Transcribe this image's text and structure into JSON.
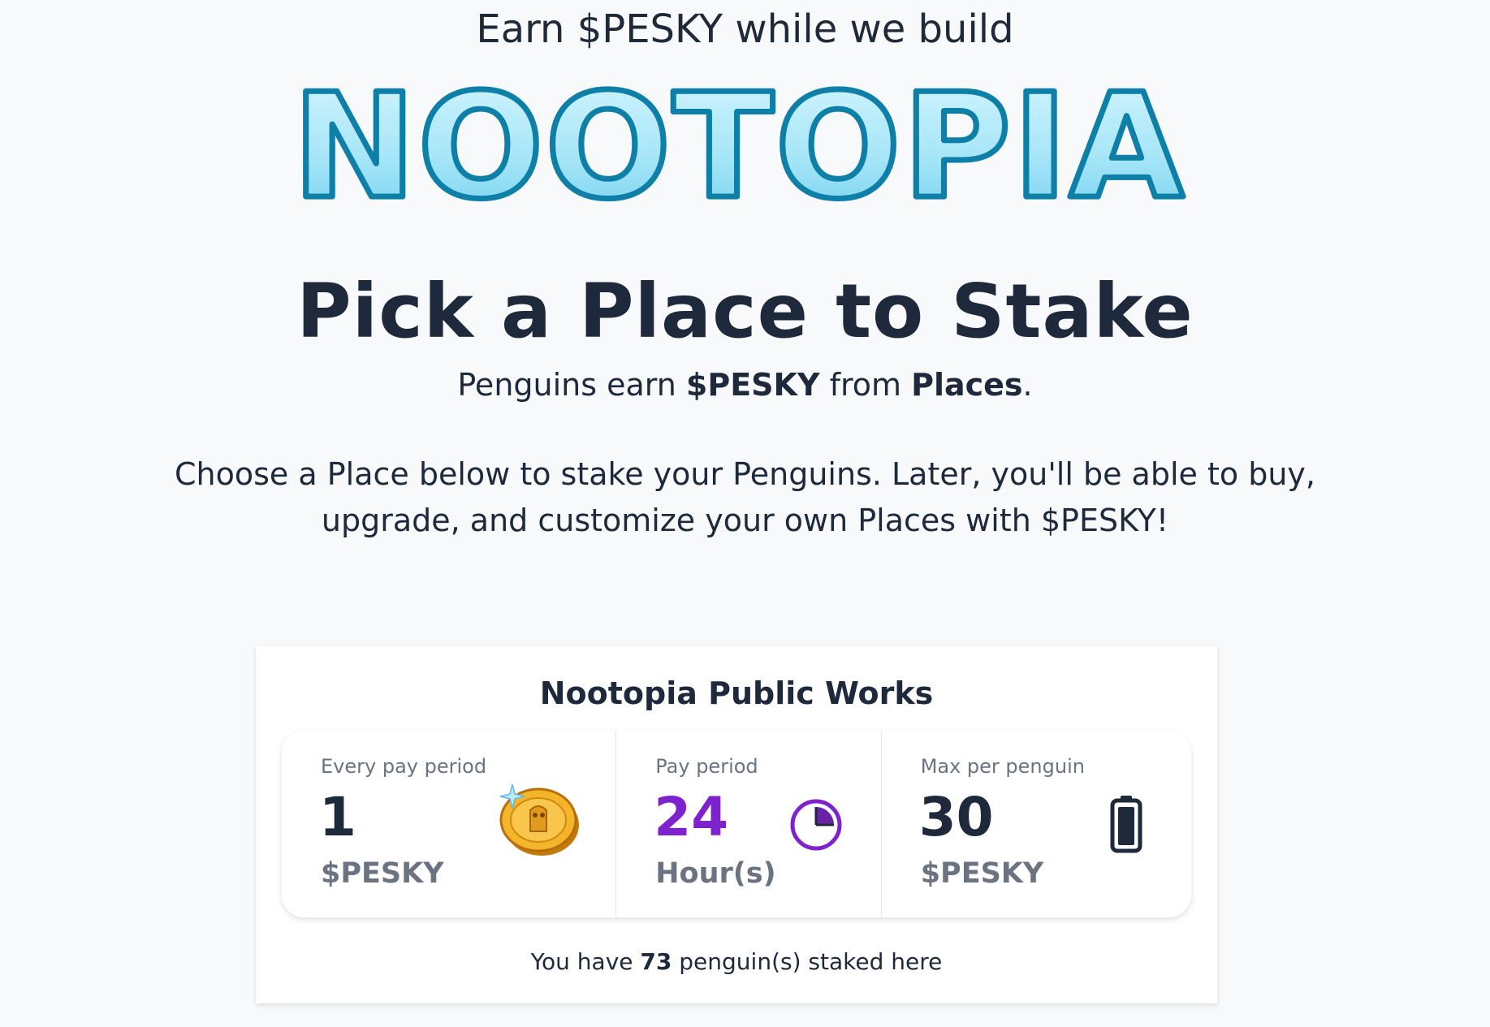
{
  "tagline": "Earn $PESKY while we build",
  "logo_text": "NOOTOPIA",
  "heading": "Pick a Place to Stake",
  "subheading": {
    "prefix": "Penguins earn ",
    "currency": "$PESKY",
    "middle": " from ",
    "places": "Places",
    "suffix": "."
  },
  "description": "Choose a Place below to stake your Penguins. Later, you'll be able to buy, upgrade, and customize your own Places with $PESKY!",
  "place": {
    "title": "Nootopia Public Works",
    "stats": [
      {
        "label": "Every pay period",
        "value": "1",
        "unit": "$PESKY",
        "icon": "coin-icon"
      },
      {
        "label": "Pay period",
        "value": "24",
        "unit": "Hour(s)",
        "icon": "clock-icon"
      },
      {
        "label": "Max per penguin",
        "value": "30",
        "unit": "$PESKY",
        "icon": "battery-icon"
      }
    ],
    "staked": {
      "prefix": "You have ",
      "count": "73",
      "suffix": " penguin(s) staked here"
    }
  },
  "colors": {
    "accent_purple": "#7e22ce",
    "logo_ice": "#b9ecfb",
    "logo_outline": "#0e7fa6",
    "text_dark": "#1e293b",
    "text_muted": "#6b7280"
  }
}
